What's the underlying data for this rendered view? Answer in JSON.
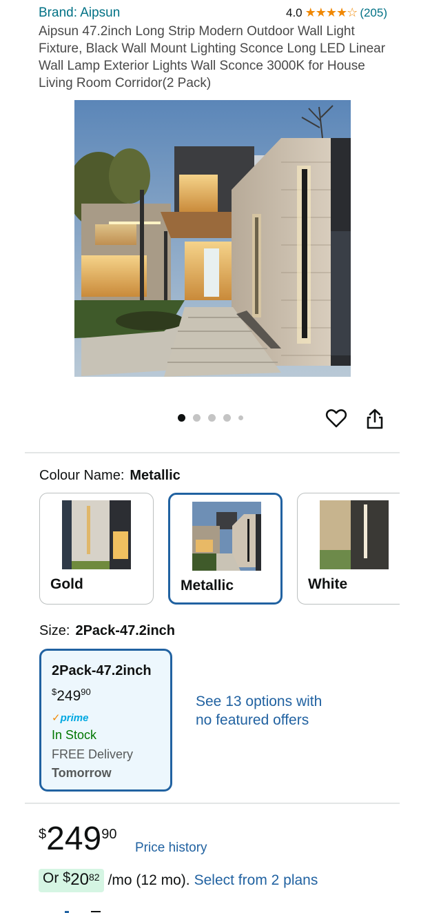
{
  "product": {
    "brand": "Brand: Aipsun",
    "rating": "4.0",
    "rating_value": 4.0,
    "stars_text": "★★★★☆",
    "review_count": "(205)",
    "title": "Aipsun 47.2inch Long Strip Modern Outdoor Wall Light Fixture, Black Wall Mount Lighting Sconce Long LED Linear Wall Lamp Exterior Lights Wall Sconce 3000K for House Living Room Corridor(2 Pack)"
  },
  "gallery": {
    "image_count": 5,
    "active_index": 0,
    "heart_icon": "heart-icon",
    "share_icon": "share-icon"
  },
  "colour": {
    "label": "Colour Name:",
    "selected": "Metallic",
    "options": [
      {
        "name": "Gold"
      },
      {
        "name": "Metallic"
      },
      {
        "name": "White"
      }
    ]
  },
  "size": {
    "label": "Size:",
    "selected": "2Pack-47.2inch",
    "card": {
      "name": "2Pack-47.2inch",
      "price_symbol": "$",
      "price_whole": "249",
      "price_fraction": "90",
      "prime_check": "✓",
      "prime_label": "prime",
      "stock": "In Stock",
      "delivery": "FREE Delivery",
      "delivery_day": "Tomorrow"
    },
    "see_options": "See 13 options with no featured offers"
  },
  "pricing": {
    "symbol": "$",
    "whole": "249",
    "fraction": "90",
    "price_history": "Price history",
    "monthly_prefix": "Or ",
    "monthly_symbol": "$",
    "monthly_whole": "20",
    "monthly_fraction": "82",
    "monthly_suffix": "/mo (12 mo).",
    "select_plans": "Select from 2 plans"
  },
  "colors": {
    "link": "#007185",
    "accent_blue": "#2162a1",
    "star": "#f08804",
    "in_stock": "#007600",
    "selected_bg": "#edf7fd",
    "monthly_bg": "#d5f5e3"
  }
}
